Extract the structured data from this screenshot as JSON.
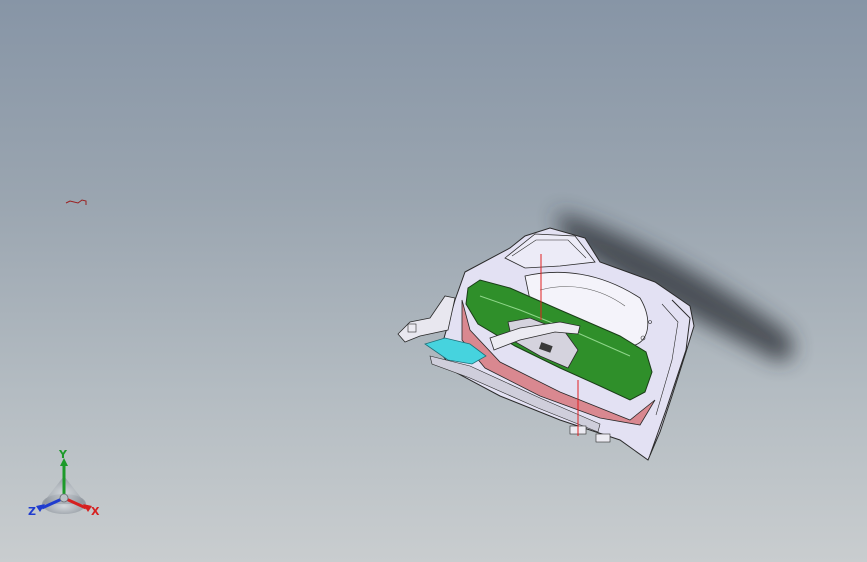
{
  "viewport": {
    "background_top": "#8795a6",
    "background_bottom": "#c9cdcf"
  },
  "model": {
    "name": "door-inner-panel-assembly",
    "colors": {
      "panel": "#e6e4f4",
      "armrest_green": "#2f8f2a",
      "lower_trim_red": "#d9868c",
      "window_cyan": "#46d3de",
      "edge": "#2a2a2a"
    }
  },
  "triad": {
    "x_label": "X",
    "y_label": "Y",
    "z_label": "Z",
    "x_color": "#d62020",
    "y_color": "#1d9a2a",
    "z_color": "#1f3ccf"
  }
}
